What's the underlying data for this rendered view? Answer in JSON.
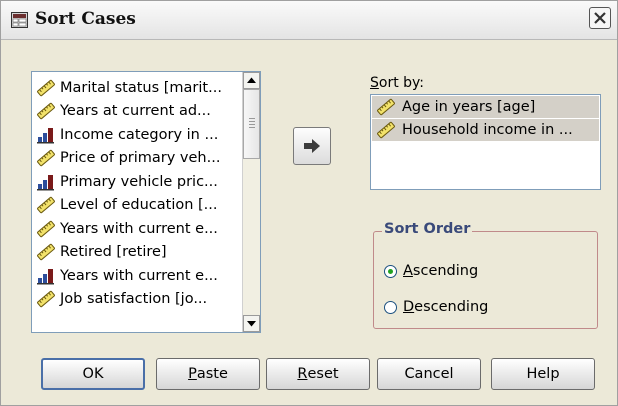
{
  "window": {
    "title": "Sort Cases"
  },
  "colors": {
    "selection": "#d4d0c8",
    "group_border": "#c08a8a",
    "group_title": "#3a4a7a"
  },
  "variables": [
    {
      "label": "Marital status [marit...",
      "icon": "ruler-icon"
    },
    {
      "label": "Years at current ad...",
      "icon": "ruler-icon"
    },
    {
      "label": "Income category in ...",
      "icon": "ordinal-bar-icon"
    },
    {
      "label": "Price of primary veh...",
      "icon": "ruler-icon"
    },
    {
      "label": "Primary vehicle pric...",
      "icon": "ordinal-bar-icon"
    },
    {
      "label": "Level of education [...",
      "icon": "ruler-icon"
    },
    {
      "label": "Years with current e...",
      "icon": "ruler-icon"
    },
    {
      "label": "Retired [retire]",
      "icon": "ruler-icon"
    },
    {
      "label": "Years with current e...",
      "icon": "ordinal-bar-icon"
    },
    {
      "label": "Job satisfaction [jo...",
      "icon": "ruler-icon"
    }
  ],
  "sort_by": {
    "label_accel": "S",
    "label_rest": "ort by:",
    "items": [
      {
        "label": "Age in years [age]",
        "icon": "ruler-icon"
      },
      {
        "label": "Household income in ...",
        "icon": "ruler-icon"
      }
    ]
  },
  "sort_order": {
    "title": "Sort Order",
    "ascending": {
      "accel": "A",
      "rest": "scending",
      "selected": true
    },
    "descending": {
      "accel": "D",
      "rest": "escending",
      "selected": false
    }
  },
  "buttons": {
    "ok": "OK",
    "paste_accel": "P",
    "paste_rest": "aste",
    "reset_accel": "R",
    "reset_rest": "eset",
    "cancel": "Cancel",
    "help": "Help"
  }
}
